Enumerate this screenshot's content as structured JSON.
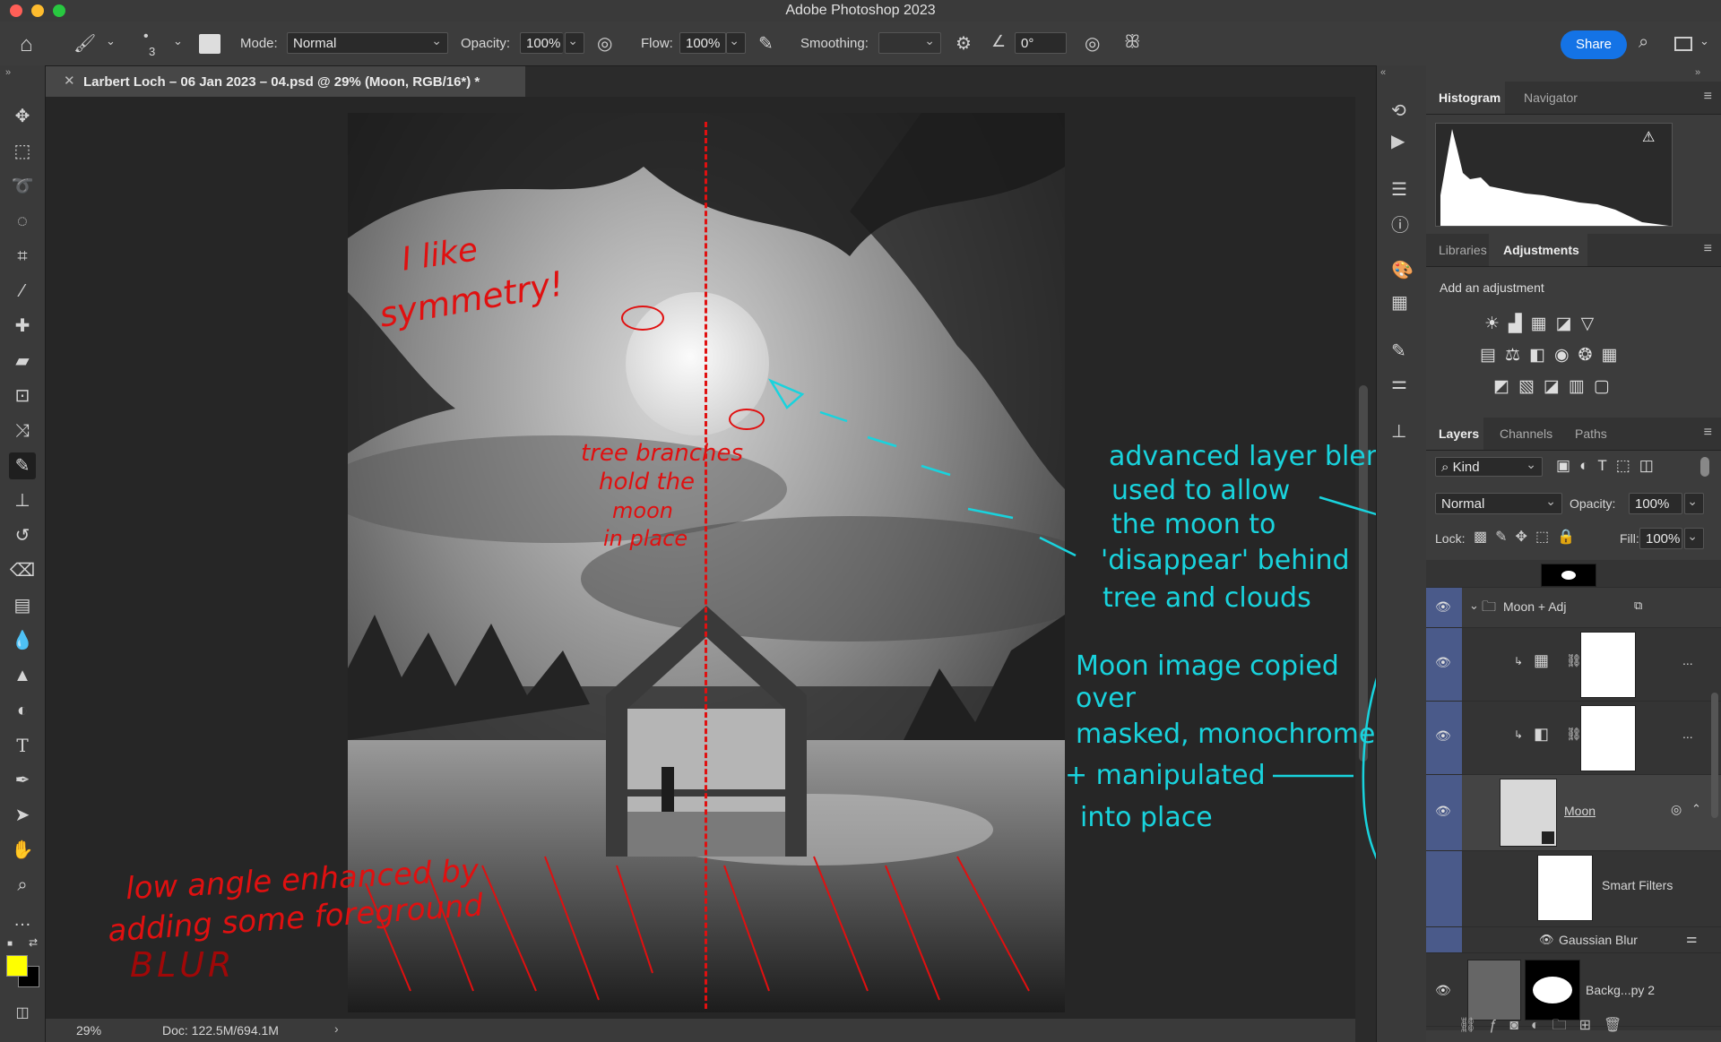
{
  "app": {
    "title": "Adobe Photoshop 2023"
  },
  "options": {
    "brush_size": "3",
    "mode_label": "Mode:",
    "mode_value": "Normal",
    "opacity_label": "Opacity:",
    "opacity_value": "100%",
    "flow_label": "Flow:",
    "flow_value": "100%",
    "smoothing_label": "Smoothing:",
    "smoothing_value": "",
    "angle_value": "0°",
    "share_label": "Share"
  },
  "document": {
    "tab_title": "Larbert Loch – 06 Jan 2023 – 04.psd @ 29% (Moon, RGB/16*) *"
  },
  "status": {
    "zoom": "29%",
    "doc_size": "Doc: 122.5M/694.1M"
  },
  "histogram_panel": {
    "tabs": [
      "Histogram",
      "Navigator"
    ]
  },
  "adjustments_panel": {
    "tabs": [
      "Libraries",
      "Adjustments"
    ],
    "add_label": "Add an adjustment"
  },
  "layers_panel": {
    "tabs": [
      "Layers",
      "Channels",
      "Paths"
    ],
    "filter_kind": "Kind",
    "blend_mode": "Normal",
    "opacity_label": "Opacity:",
    "opacity_value": "100%",
    "lock_label": "Lock:",
    "fill_label": "Fill:",
    "fill_value": "100%",
    "layers": {
      "group": "Moon + Adj",
      "moon": "Moon",
      "smart_filters": "Smart Filters",
      "gaussian_blur": "Gaussian Blur",
      "background_copy": "Backg...py 2",
      "more": "..."
    }
  },
  "annotations": {
    "red": {
      "symmetry": [
        "I like",
        "symmetry!"
      ],
      "branches": [
        "tree branches",
        "hold the",
        "moon",
        "in place"
      ],
      "low_angle": [
        "low angle enhanced by",
        "adding some foreground",
        "BLUR"
      ]
    },
    "cyan": {
      "blending": [
        "advanced layer blending",
        "used to allow",
        "the moon to",
        "'disappear' behind",
        "tree and clouds"
      ],
      "moon_image": [
        "Moon image copied",
        "over",
        "masked, monochromed",
        "+ manipulated",
        "into place"
      ]
    }
  },
  "colors": {
    "accent": "#1473e6",
    "foreground": "#ffff00",
    "background": "#000000",
    "annotation_red": "#e01010",
    "annotation_cyan": "#19d3dd",
    "layer_selected": "#4a5a8a"
  }
}
